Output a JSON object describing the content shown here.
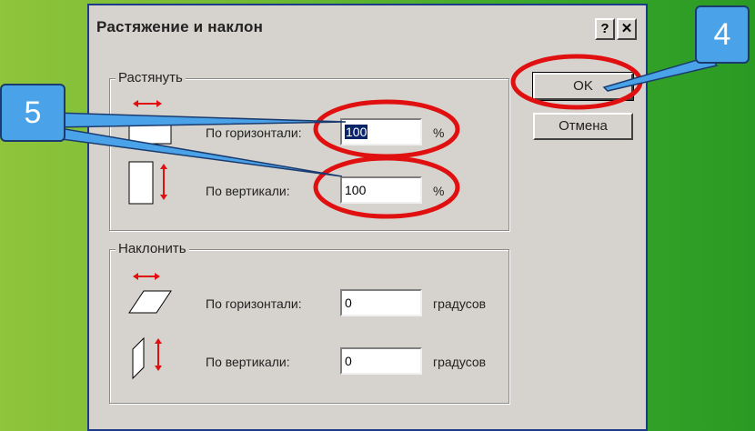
{
  "dialog": {
    "title": "Растяжение и наклон",
    "help_button": "?",
    "close_button": "✕"
  },
  "stretch": {
    "legend": "Растянуть",
    "horizontal_label": "По горизонтали:",
    "horizontal_value": "100",
    "horizontal_unit": "%",
    "vertical_label": "По вертикали:",
    "vertical_value": "100",
    "vertical_unit": "%"
  },
  "skew": {
    "legend": "Наклонить",
    "horizontal_label": "По горизонтали:",
    "horizontal_value": "0",
    "horizontal_unit": "градусов",
    "vertical_label": "По вертикали:",
    "vertical_value": "0",
    "vertical_unit": "градусов"
  },
  "buttons": {
    "ok": "OK",
    "cancel": "Отмена"
  },
  "annotations": {
    "callout_4": "4",
    "callout_5": "5",
    "highlight_color": "#e01010",
    "callout_color": "#4aa3e8"
  }
}
